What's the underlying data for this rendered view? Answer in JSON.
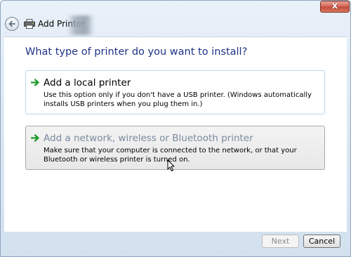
{
  "window": {
    "title": "Add Printer",
    "close_label": "x"
  },
  "icons": {
    "back": "back-arrow-icon",
    "printer": "printer-icon",
    "option_arrow": "green-arrow-icon",
    "cursor": "mouse-cursor-icon"
  },
  "main": {
    "heading": "What type of printer do you want to install?",
    "options": [
      {
        "title": "Add a local printer",
        "description": "Use this option only if you don't have a USB printer. (Windows automatically installs USB printers when you plug them in.)"
      },
      {
        "title": "Add a network, wireless or Bluetooth printer",
        "description": "Make sure that your computer is connected to the network, or that your Bluetooth or wireless printer is turned on."
      }
    ]
  },
  "footer": {
    "next_label": "Next",
    "cancel_label": "Cancel"
  },
  "colors": {
    "heading": "#1e3287",
    "option_border": "#b7d8ef",
    "close_red": "#c24b3a",
    "arrow_green": "#1b9b2a"
  }
}
